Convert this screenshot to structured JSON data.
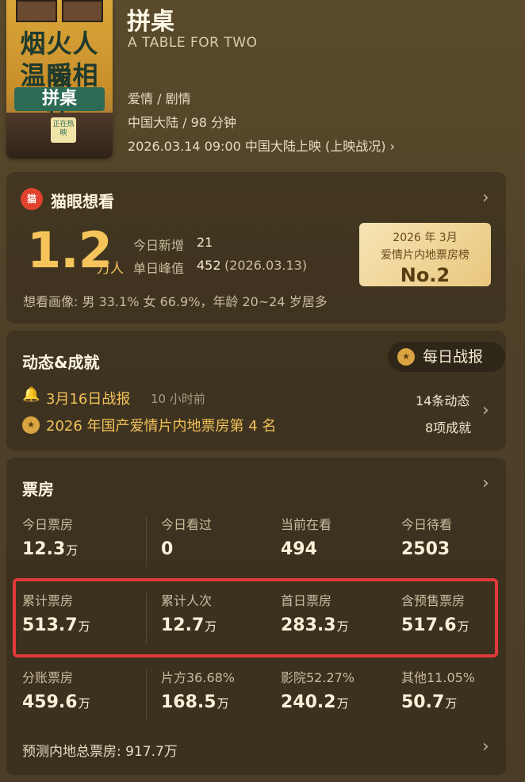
{
  "movie": {
    "poster": {
      "line1": "烟火人间",
      "line2": "温暖相伴",
      "sign": "拼桌",
      "tag": "正在热映"
    },
    "title": "拼桌",
    "en_title": "A TABLE FOR TWO",
    "genres": "爱情 / 剧情",
    "region_duration": "中国大陆 / 98 分钟",
    "release": "2026.03.14 09:00 中国大陆上映 (上映战况)",
    "release_chevron": "›"
  },
  "want": {
    "logo": "猫",
    "title": "猫眼想看",
    "big_number": "1.2",
    "big_unit": "万人",
    "today_new_label": "今日新增",
    "today_new_value": "21",
    "peak_label": "单日峰值",
    "peak_value": "452",
    "peak_date": "(2026.03.13)",
    "rank_line1": "2026 年 3月",
    "rank_line2": "爱情片内地票房榜",
    "rank_value": "No.2",
    "portrait": "想看画像: 男 33.1%  女 66.9%，年龄 20~24 岁居多",
    "chevron": "›"
  },
  "dynamics": {
    "title": "动态&成就",
    "daily_button": "每日战报",
    "item1": "3月16日战报",
    "item1_time": "10 小时前",
    "item2": "2026 年国产爱情片内地票房第 4 名",
    "count1": "14条动态",
    "count2": "8项成就",
    "chevron": "›"
  },
  "box_office": {
    "title": "票房",
    "chevron": "›",
    "row1": [
      {
        "label": "今日票房",
        "value": "12.3",
        "unit": "万"
      },
      {
        "label": "今日看过",
        "value": "0",
        "unit": ""
      },
      {
        "label": "当前在看",
        "value": "494",
        "unit": ""
      },
      {
        "label": "今日待看",
        "value": "2503",
        "unit": ""
      }
    ],
    "row2": [
      {
        "label": "累计票房",
        "value": "513.7",
        "unit": "万"
      },
      {
        "label": "累计人次",
        "value": "12.7",
        "unit": "万"
      },
      {
        "label": "首日票房",
        "value": "283.3",
        "unit": "万"
      },
      {
        "label": "含预售票房",
        "value": "517.6",
        "unit": "万"
      }
    ],
    "row3": [
      {
        "label": "分账票房",
        "value": "459.6",
        "unit": "万"
      },
      {
        "label": "片方36.68%",
        "value": "168.5",
        "unit": "万"
      },
      {
        "label": "影院52.27%",
        "value": "240.2",
        "unit": "万"
      },
      {
        "label": "其他11.05%",
        "value": "50.7",
        "unit": "万"
      }
    ],
    "forecast": "预测内地总票房: 917.7万",
    "forecast_chevron": "›"
  },
  "colors": {
    "accent_gold": "#f5c45a",
    "highlight_red": "#e23a3a"
  }
}
